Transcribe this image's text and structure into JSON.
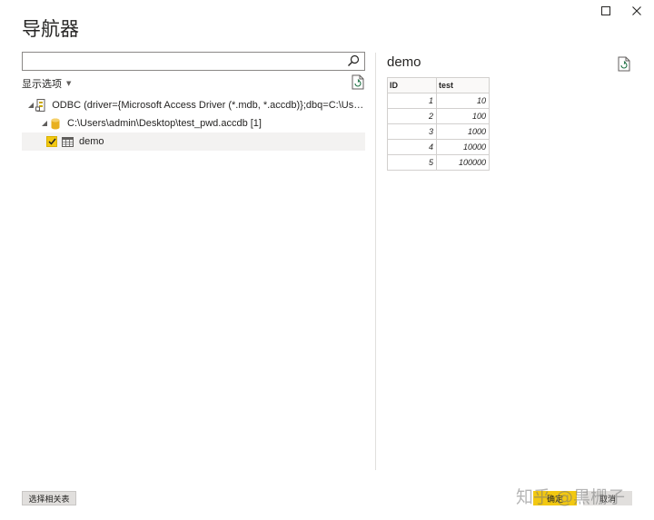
{
  "window": {
    "title": "导航器"
  },
  "search": {
    "value": "",
    "placeholder": ""
  },
  "display_options": {
    "label": "显示选项"
  },
  "tree": {
    "odbc": {
      "label": "ODBC (driver={Microsoft Access Driver (*.mdb, *.accdb)};dbq=C:\\Users\\admin..."
    },
    "file": {
      "label": "C:\\Users\\admin\\Desktop\\test_pwd.accdb [1]"
    },
    "table": {
      "label": "demo",
      "checked": true
    }
  },
  "preview": {
    "title": "demo",
    "columns": [
      "ID",
      "test"
    ],
    "rows": [
      [
        "1",
        "10"
      ],
      [
        "2",
        "100"
      ],
      [
        "3",
        "1000"
      ],
      [
        "4",
        "10000"
      ],
      [
        "5",
        "100000"
      ]
    ]
  },
  "buttons": {
    "select_related": "选择相关表",
    "ok": "确定",
    "cancel": "取消"
  },
  "watermark": {
    "text": "知乎 @黒栅子"
  },
  "colors": {
    "accent": "#f2c811",
    "border": "#8a8886",
    "divider": "#e1dfdd"
  },
  "icons": {
    "maximize": "maximize-icon",
    "close": "close-icon",
    "search": "search-icon",
    "refresh": "refresh-icon",
    "odbc": "odbc-source-icon",
    "database": "database-icon",
    "table": "table-icon"
  }
}
